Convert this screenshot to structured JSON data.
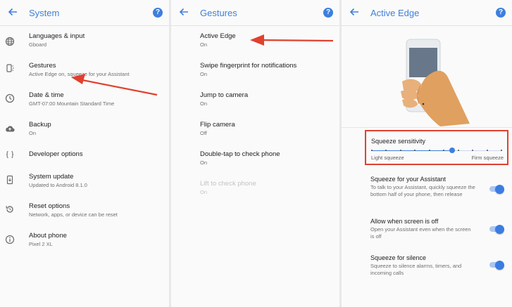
{
  "colors": {
    "accent": "#3e7fde",
    "highlight": "#e0412f",
    "background": "#fafafa"
  },
  "system": {
    "title": "System",
    "back_icon": "arrow-left-icon",
    "help_icon": "help-icon",
    "help_glyph": "?",
    "items": [
      {
        "icon": "globe-icon",
        "title": "Languages & input",
        "subtitle": "Gboard"
      },
      {
        "icon": "gestures-icon",
        "title": "Gestures",
        "subtitle": "Active Edge on, squeeze for your Assistant"
      },
      {
        "icon": "clock-icon",
        "title": "Date & time",
        "subtitle": "GMT-07:00 Mountain Standard Time"
      },
      {
        "icon": "cloud-upload-icon",
        "title": "Backup",
        "subtitle": "On"
      },
      {
        "icon": "braces-icon",
        "title": "Developer options",
        "subtitle": ""
      },
      {
        "icon": "phone-update-icon",
        "title": "System update",
        "subtitle": "Updated to Android 8.1.0"
      },
      {
        "icon": "reset-icon",
        "title": "Reset options",
        "subtitle": "Network, apps, or device can be reset"
      },
      {
        "icon": "info-icon",
        "title": "About phone",
        "subtitle": "Pixel 2 XL"
      }
    ]
  },
  "gestures": {
    "title": "Gestures",
    "items": [
      {
        "title": "Active Edge",
        "subtitle": "On",
        "enabled": true
      },
      {
        "title": "Swipe fingerprint for notifications",
        "subtitle": "On",
        "enabled": true
      },
      {
        "title": "Jump to camera",
        "subtitle": "On",
        "enabled": true
      },
      {
        "title": "Flip camera",
        "subtitle": "Off",
        "enabled": true
      },
      {
        "title": "Double-tap to check phone",
        "subtitle": "On",
        "enabled": true
      },
      {
        "title": "Lift to check phone",
        "subtitle": "On",
        "enabled": false
      }
    ]
  },
  "active_edge": {
    "title": "Active Edge",
    "illustration": "hand-squeezing-phone-illustration",
    "sensitivity": {
      "title": "Squeeze sensitivity",
      "min_label": "Light squeeze",
      "max_label": "Firm squeeze",
      "steps": 10,
      "value_fraction": 0.62
    },
    "toggles": [
      {
        "title": "Squeeze for your Assistant",
        "subtitle": "To talk to your Assistant, quickly squeeze the bottom half of your phone, then release",
        "on": true
      },
      {
        "title": "Allow when screen is off",
        "subtitle": "Open your Assistant even when the screen is off",
        "on": true
      },
      {
        "title": "Squeeze for silence",
        "subtitle": "Squeeze to silence alarms, timers, and incoming calls",
        "on": true
      }
    ]
  }
}
